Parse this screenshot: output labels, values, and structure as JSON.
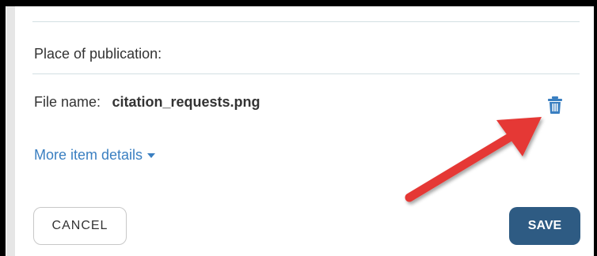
{
  "form": {
    "place_label": "Place of publication:",
    "file_label": "File name:",
    "file_value": "citation_requests.png",
    "more_details": "More item details"
  },
  "buttons": {
    "cancel": "CANCEL",
    "save": "SAVE"
  },
  "icons": {
    "delete": "trash-icon",
    "expand": "caret-down-icon"
  },
  "colors": {
    "link": "#3a7fc1",
    "primary_button": "#2e5b83",
    "annotation_arrow": "#e53935"
  }
}
